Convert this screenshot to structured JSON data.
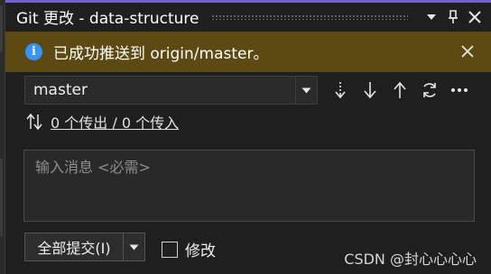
{
  "window": {
    "title": "Git 更改 - data-structure"
  },
  "info_bar": {
    "message": "已成功推送到 origin/master。"
  },
  "branch": {
    "selected": "master"
  },
  "sync": {
    "link_text": "0 个传出 / 0 个传入"
  },
  "commit_message": {
    "placeholder": "输入消息 <必需>"
  },
  "commit": {
    "button_label": "全部提交(I)"
  },
  "amend": {
    "label": "修改",
    "checked": false
  },
  "watermark": "CSDN @封心心心心",
  "colors": {
    "accent": "#6f62c9",
    "info_background": "#5c4a12",
    "info_icon": "#3794ff",
    "background": "#1f1f1f"
  },
  "icons": {
    "title_actions": [
      "chevron-down-icon",
      "pin-icon",
      "close-icon"
    ],
    "branch_actions": [
      "fetch-icon",
      "pull-icon",
      "push-icon",
      "sync-icon",
      "more-icon"
    ]
  }
}
